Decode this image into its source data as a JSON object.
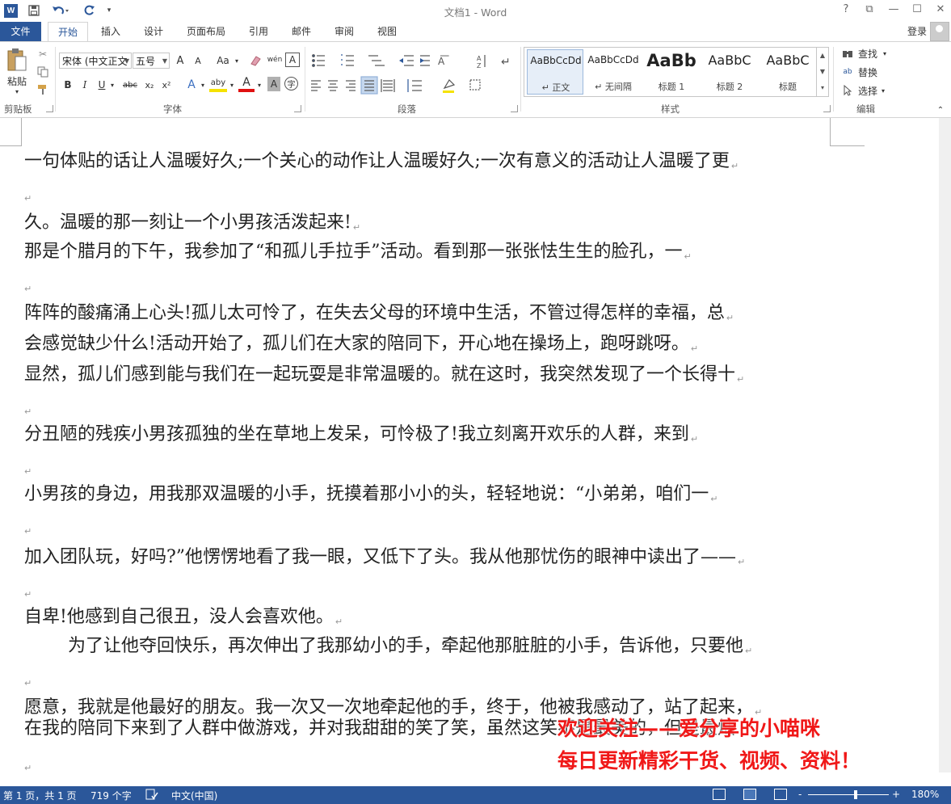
{
  "titlebar": {
    "title": "文档1 - Word",
    "app_badge": "W",
    "help": "?",
    "restore_ribbon": "⧉",
    "minimize": "—",
    "maximize": "☐",
    "close": "✕",
    "quick_access": [
      "save-icon",
      "undo-icon",
      "redo-icon",
      "customize-icon"
    ]
  },
  "tabs": {
    "file": "文件",
    "items": [
      "开始",
      "插入",
      "设计",
      "页面布局",
      "引用",
      "邮件",
      "审阅",
      "视图"
    ],
    "active": "开始",
    "login": "登录"
  },
  "ribbon": {
    "clipboard": {
      "paste": "粘贴",
      "group": "剪贴板"
    },
    "font": {
      "name": "宋体 (中文正文",
      "size": "五号",
      "grow": "A",
      "shrink": "A",
      "case": "Aa",
      "phonetic": "wén",
      "border_char": "A",
      "bold": "B",
      "italic": "I",
      "underline": "U",
      "strike": "abc",
      "subscript": "x₂",
      "superscript": "x²",
      "text_effect": "A",
      "highlight": "aby",
      "font_color": "A",
      "shading": "A",
      "enclose": "字",
      "group": "字体"
    },
    "paragraph": {
      "group": "段落"
    },
    "styles": {
      "group": "样式",
      "items": [
        {
          "preview": "AaBbCcDd",
          "name": "↵ 正文"
        },
        {
          "preview": "AaBbCcDd",
          "name": "↵ 无间隔"
        },
        {
          "preview": "AaBb",
          "name": "标题 1"
        },
        {
          "preview": "AaBbC",
          "name": "标题 2"
        },
        {
          "preview": "AaBbC",
          "name": "标题"
        }
      ]
    },
    "editing": {
      "find": "查找",
      "replace": "替换",
      "select": "选择",
      "group": "编辑"
    }
  },
  "document": {
    "lines": [
      {
        "text": "一句体贴的话让人温暖好久;一个关心的动作让人温暖好久;一次有意义的活动让人温暖了更"
      },
      {
        "text": ""
      },
      {
        "text": "久。温暖的那一刻让一个小男孩活泼起来!"
      },
      {
        "text": "那是个腊月的下午，我参加了“和孤儿手拉手”活动。看到那一张张怯生生的脸孔，一"
      },
      {
        "text": ""
      },
      {
        "text": "阵阵的酸痛涌上心头!孤儿太可怜了，在失去父母的环境中生活，不管过得怎样的幸福，总"
      },
      {
        "text": "会感觉缺少什么!活动开始了，孤儿们在大家的陪同下，开心地在操场上，跑呀跳呀。"
      },
      {
        "text": "显然，孤儿们感到能与我们在一起玩耍是非常温暖的。就在这时，我突然发现了一个长得十"
      },
      {
        "text": ""
      },
      {
        "text": "分丑陋的残疾小男孩孤独的坐在草地上发呆，可怜极了!我立刻离开欢乐的人群，来到"
      },
      {
        "text": ""
      },
      {
        "text": "小男孩的身边，用我那双温暖的小手，抚摸着那小小的头，轻轻地说：“小弟弟，咱们一"
      },
      {
        "text": ""
      },
      {
        "text": "加入团队玩，好吗?”他愣愣地看了我一眼，又低下了头。我从他那忧伤的眼神中读出了——"
      },
      {
        "text": ""
      },
      {
        "text": "自卑!他感到自己很丑，没人会喜欢他。"
      },
      {
        "text": "为了让他夺回快乐，再次伸出了我那幼小的手，牵起他那脏脏的小手，告诉他，只要他"
      },
      {
        "text": ""
      },
      {
        "text": "愿意，我就是他最好的朋友。我一次又一次地牵起他的手，终于，他被我感动了，站了起来，"
      },
      {
        "text": "在我的陪同下来到了人群中做游戏，并对我甜甜的笑了笑，虽然这笑不是最美的，但是最灿"
      },
      {
        "text": ""
      }
    ],
    "paragraph_mark": "↵"
  },
  "overlay": {
    "line1": "欢迎关注——爱分享的小喵咪",
    "line2": "每日更新精彩干货、视频、资料！",
    "color": "#f01818"
  },
  "statusbar": {
    "page": "第 1 页，共 1 页",
    "words": "719 个字",
    "language": "中文(中国)",
    "zoom": "180%",
    "zoom_minus": "-",
    "zoom_plus": "+",
    "accent": "#2b579a"
  }
}
